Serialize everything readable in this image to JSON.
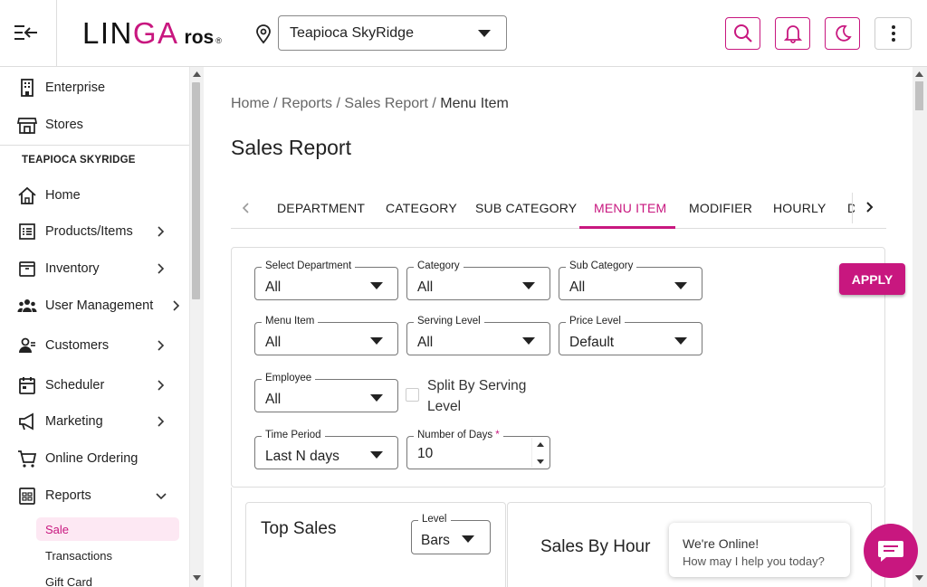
{
  "header": {
    "logo_main": "LIN",
    "logo_accent": "GA",
    "logo_ros": "ros",
    "logo_reg": "®",
    "store_name": "Teapioca SkyRidge"
  },
  "sidebar": {
    "top_items": [
      {
        "label": "Enterprise",
        "icon": "building-icon"
      },
      {
        "label": "Stores",
        "icon": "store-icon"
      }
    ],
    "store_header": "TEAPIOCA SKYRIDGE",
    "items": [
      {
        "label": "Home",
        "icon": "home-icon"
      },
      {
        "label": "Products/Items",
        "icon": "list-icon"
      },
      {
        "label": "Inventory",
        "icon": "box-icon"
      },
      {
        "label": "User Management",
        "icon": "users-icon"
      },
      {
        "label": "Customers",
        "icon": "customers-icon"
      },
      {
        "label": "Scheduler",
        "icon": "calendar-icon"
      },
      {
        "label": "Marketing",
        "icon": "megaphone-icon"
      },
      {
        "label": "Online Ordering",
        "icon": "cart-icon"
      },
      {
        "label": "Reports",
        "icon": "reports-icon"
      }
    ],
    "report_subitems": [
      "Sale",
      "Transactions",
      "Gift Card"
    ]
  },
  "breadcrumb": [
    "Home",
    "Reports",
    "Sales Report",
    "Menu Item"
  ],
  "breadcrumb_sep": " / ",
  "page_title": "Sales Report",
  "tabs": [
    "DEPARTMENT",
    "CATEGORY",
    "SUB CATEGORY",
    "MENU ITEM",
    "MODIFIER",
    "HOURLY",
    "D"
  ],
  "active_tab": "MENU ITEM",
  "filters": {
    "department": {
      "label": "Select Department",
      "value": "All"
    },
    "category": {
      "label": "Category",
      "value": "All"
    },
    "sub_category": {
      "label": "Sub Category",
      "value": "All"
    },
    "menu_item": {
      "label": "Menu Item",
      "value": "All"
    },
    "serving_level": {
      "label": "Serving Level",
      "value": "All"
    },
    "price_level": {
      "label": "Price Level",
      "value": "Default"
    },
    "employee": {
      "label": "Employee",
      "value": "All"
    },
    "split_label": "Split By Serving Level",
    "split_checked": false,
    "time_period": {
      "label": "Time Period",
      "value": "Last N days"
    },
    "num_days": {
      "label": "Number of Days",
      "required_mark": "*",
      "value": "10"
    },
    "apply_label": "APPLY"
  },
  "top_sales": {
    "title": "Top Sales",
    "level_label": "Level",
    "level_value": "Bars"
  },
  "sales_by_hour": {
    "title": "Sales By Hour"
  },
  "chat": {
    "line1": "We're Online!",
    "line2": "How may I help you today?"
  },
  "colors": {
    "accent": "#c8177f"
  }
}
